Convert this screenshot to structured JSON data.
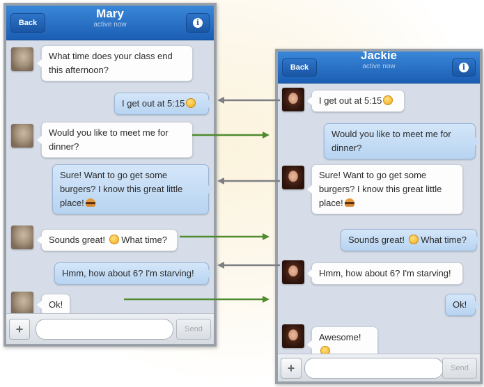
{
  "left_phone": {
    "back_label": "Back",
    "contact_name": "Mary",
    "status": "active now",
    "info_glyph": "i",
    "messages": [
      {
        "from": "them",
        "text": "What time does your class end this afternoon?"
      },
      {
        "from": "me",
        "text": "I get out at 5:15",
        "emoji": "smiley"
      },
      {
        "from": "them",
        "text": "Would you like to meet me for dinner?"
      },
      {
        "from": "me",
        "text": "Sure! Want to go get some burgers? I know this great little place!",
        "emoji": "burger"
      },
      {
        "from": "them",
        "text": "Sounds great!",
        "text_after": "What time?",
        "emoji": "grin"
      },
      {
        "from": "me",
        "text": "Hmm, how about 6? I'm starving!"
      },
      {
        "from": "them",
        "text": "Ok!"
      }
    ],
    "input_placeholder": "",
    "plus_label": "+",
    "send_label": "Send"
  },
  "right_phone": {
    "back_label": "Back",
    "contact_name": "Jackie",
    "status": "active now",
    "info_glyph": "i",
    "messages": [
      {
        "from": "them",
        "text": "I get out at 5:15",
        "emoji": "smiley"
      },
      {
        "from": "me",
        "text": "Would you like to meet me for dinner?"
      },
      {
        "from": "them",
        "text": "Sure! Want to go get some burgers? I know this great little place!",
        "emoji": "burger"
      },
      {
        "from": "me",
        "text": "Sounds great!",
        "text_after": "What time?",
        "emoji": "grin"
      },
      {
        "from": "them",
        "text": "Hmm, how about 6? I'm starving!"
      },
      {
        "from": "me",
        "text": "Ok!"
      },
      {
        "from": "them",
        "text": "Awesome!",
        "emoji": "smiley"
      }
    ],
    "input_placeholder": "",
    "plus_label": "+",
    "send_label": "Send"
  },
  "icons": {
    "info": "info-icon",
    "plus": "plus-icon",
    "avatar_left": "mary-avatar",
    "avatar_right": "jackie-avatar"
  },
  "colors": {
    "navbar": "#1b5eb4",
    "sent_bubble": "#c6ddf5",
    "received_bubble": "#fdfdfd",
    "arrow_gray": "#7d7f84",
    "arrow_green": "#4e8a2e"
  }
}
